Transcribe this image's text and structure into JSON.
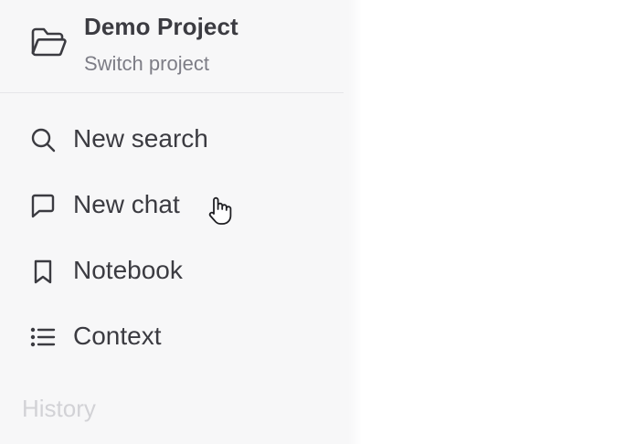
{
  "project": {
    "title": "Demo Project",
    "subtitle": "Switch project",
    "icon": "folder-open-icon"
  },
  "nav": {
    "items": [
      {
        "label": "New search",
        "icon": "search-icon"
      },
      {
        "label": "New chat",
        "icon": "chat-icon"
      },
      {
        "label": "Notebook",
        "icon": "bookmark-icon"
      },
      {
        "label": "Context",
        "icon": "list-icon"
      }
    ]
  },
  "history": {
    "heading": "History"
  },
  "colors": {
    "sidebar_bg": "#f7f7f8",
    "text": "#3b3b41",
    "muted": "#7d7d86",
    "faded": "#d2d2d6"
  }
}
